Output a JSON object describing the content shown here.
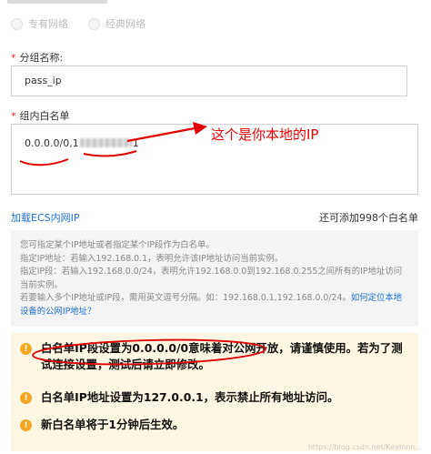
{
  "network_type": {
    "options": [
      "专有网络",
      "经典网络"
    ]
  },
  "group_name": {
    "label": "分组名称:",
    "value": "pass_ip"
  },
  "whitelist": {
    "label": "组内白名单",
    "value_visible": "0.0.0.0/0,1",
    "value_tail": "1"
  },
  "load_ecs_link": "加载ECS内网IP",
  "remaining_text": "还可添加998个白名单",
  "help": {
    "line1": "您可指定某个IP地址或者指定某个IP段作为白名单。",
    "line2": "指定IP地址：若输入192.168.0.1，表明允许该IP地址访问当前实例。",
    "line3": "指定IP段：若输入192.168.0.0/24，表明允许192.168.0.0到192.168.0.255之间所有的IP地址访问当前实例。",
    "line4": "若要输入多个IP地址或IP段，需用英文逗号分隔。如：192.168.0.1,192.168.0.0/24。",
    "link": "如何定位本地设备的公网IP地址？"
  },
  "warnings": [
    "白名单IP段设置为0.0.0.0/0意味着对公网开放，请谨慎使用。若为了测试连接设置，测试后请立即修改。",
    "白名单IP地址设置为127.0.0.1，表示禁止所有地址访问。",
    "新白名单将于1分钟后生效。"
  ],
  "annotation": {
    "text": "这个是你本地的IP",
    "color": "#e00000"
  },
  "watermark": "https://blog.csdn.net/Kevinnn..."
}
